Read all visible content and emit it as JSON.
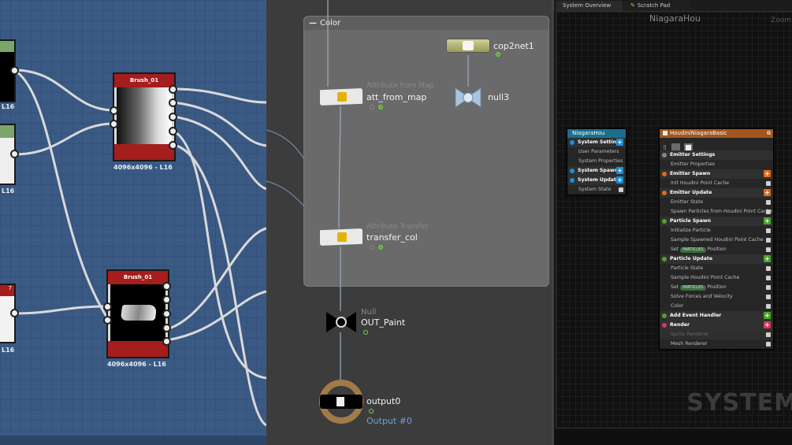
{
  "substance": {
    "node1": {
      "title": "Brush_01",
      "res": "4096x4096 - L16"
    },
    "node2": {
      "title": "Brush_01",
      "res": "4096x4096 - L16"
    },
    "left_labels": [
      "L16",
      "L16",
      "L16"
    ],
    "partial_title": "7",
    "colors": {
      "bg": "#3a5a84",
      "header": "#a51d1d"
    }
  },
  "houdini": {
    "subnet_title": "Color",
    "nodes": {
      "cop2net": {
        "label": "cop2net1"
      },
      "null3": {
        "label": "null3"
      },
      "att_from_map": {
        "label": "att_from_map",
        "ghost": "Attribute from Map"
      },
      "transfer_col": {
        "label": "transfer_col",
        "ghost": "Attribute Transfer"
      },
      "out_paint": {
        "label": "OUT_Paint",
        "ghost": "Null"
      },
      "output0": {
        "label": "output0",
        "sublabel": "Output #0"
      }
    }
  },
  "niagara": {
    "tabs": [
      "System Overview",
      "Scratch Pad"
    ],
    "graph_title": "NiagaraHou",
    "zoom_label": "Zoom",
    "watermark": "SYSTEM",
    "system_node": {
      "title": "NiagaraHou",
      "rows": [
        {
          "label": "System Settings",
          "type": "sec",
          "plus": "#1a8fd6"
        },
        {
          "label": "User Parameters",
          "type": "sub"
        },
        {
          "label": "System Properties",
          "type": "sub"
        },
        {
          "label": "System Spawn",
          "type": "sec",
          "plus": "#1a8fd6"
        },
        {
          "label": "System Update",
          "type": "sec",
          "plus": "#1a8fd6"
        },
        {
          "label": "System State",
          "type": "sub",
          "check": true
        }
      ]
    },
    "emitter_node": {
      "title": "HoudiniNiagaraBasic",
      "rows": [
        {
          "label": "Emitter Settings",
          "type": "sec"
        },
        {
          "label": "Emitter Properties",
          "type": "sub"
        },
        {
          "label": "Emitter Spawn",
          "type": "sec",
          "plus": "#e06b1f"
        },
        {
          "label": "Init Houdini Point Cache",
          "type": "sub",
          "check": true
        },
        {
          "label": "Emitter Update",
          "type": "sec",
          "plus": "#e06b1f"
        },
        {
          "label": "Emitter State",
          "type": "sub",
          "check": true
        },
        {
          "label": "Spawn Particles from Houdini Point Cache",
          "type": "sub",
          "check": true
        },
        {
          "label": "Particle Spawn",
          "type": "sec",
          "plus": "#4aa52a"
        },
        {
          "label": "Initialize Particle",
          "type": "sub",
          "check": true
        },
        {
          "label": "Sample Spawned Houdini Point Cache",
          "type": "sub",
          "check": true
        },
        {
          "label": "Set",
          "pill": "PARTICLES",
          "after": "Position",
          "type": "sub",
          "check": true
        },
        {
          "label": "Particle Update",
          "type": "sec",
          "plus": "#4aa52a"
        },
        {
          "label": "Particle State",
          "type": "sub",
          "check": true
        },
        {
          "label": "Sample Houdini Point Cache",
          "type": "sub",
          "check": true
        },
        {
          "label": "Set",
          "pill": "PARTICLES",
          "after": "Position",
          "type": "sub",
          "check": true
        },
        {
          "label": "Solve Forces and Velocity",
          "type": "sub",
          "check": true
        },
        {
          "label": "Color",
          "type": "sub",
          "check": true
        },
        {
          "label": "Add Event Handler",
          "type": "sec",
          "plus": "#4aa52a"
        },
        {
          "label": "Render",
          "type": "sec",
          "plus": "#d63b57"
        },
        {
          "label": "Sprite Renderer",
          "type": "sub",
          "check": true,
          "dim": true
        },
        {
          "label": "Mesh Renderer",
          "type": "sub",
          "check": true
        }
      ]
    }
  }
}
